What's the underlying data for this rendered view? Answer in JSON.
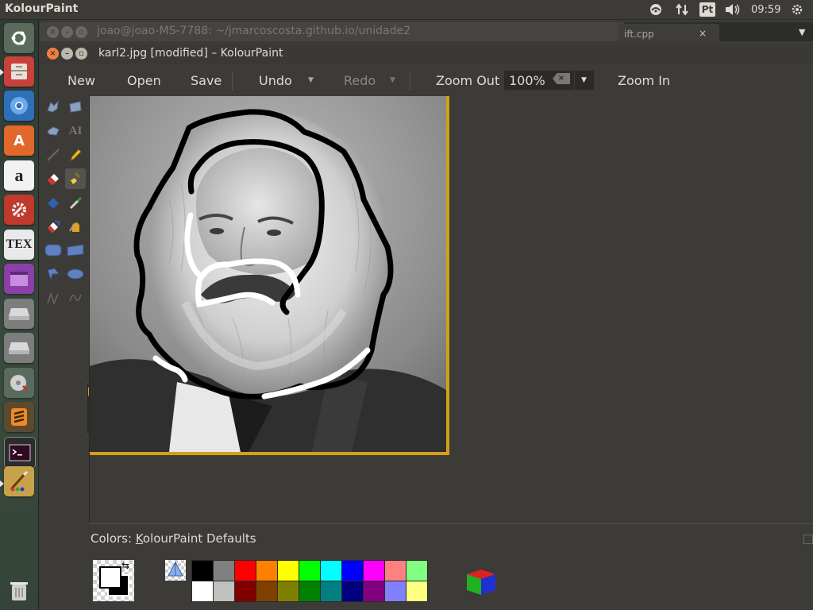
{
  "top_panel": {
    "app_name": "KolourPaint",
    "lang": "Pt",
    "volume_icon": "speaker-icon",
    "time": "09:59"
  },
  "launcher": {
    "items": [
      {
        "name": "ubuntu-home",
        "icon": "ubuntu-logo-icon"
      },
      {
        "name": "files",
        "icon": "file-cabinet-icon"
      },
      {
        "name": "chromium",
        "icon": "browser-icon"
      },
      {
        "name": "software-center",
        "icon": "shopping-bag-icon"
      },
      {
        "name": "amazon",
        "icon": "amazon-icon"
      },
      {
        "name": "system-settings",
        "icon": "settings-icon"
      },
      {
        "name": "texmaker",
        "icon": "tex-icon"
      },
      {
        "name": "app-window",
        "icon": "window-icon"
      },
      {
        "name": "drive-1",
        "icon": "drive-icon"
      },
      {
        "name": "drive-2",
        "icon": "drive-icon"
      },
      {
        "name": "disk-utility",
        "icon": "disk-icon"
      },
      {
        "name": "sublime-text",
        "icon": "sublime-icon"
      },
      {
        "name": "terminal",
        "icon": "terminal-icon"
      },
      {
        "name": "kolourpaint",
        "icon": "kolourpaint-icon"
      },
      {
        "name": "trash",
        "icon": "trash-icon"
      }
    ]
  },
  "background_window": {
    "title": "joao@joao-MS-7788: ~/jmarcoscosta.github.io/unidade2",
    "tab_label": "ift.cpp",
    "tab_close": "×"
  },
  "window": {
    "title": "karl2.jpg [modified] – KolourPaint"
  },
  "toolbar": {
    "new": "New",
    "open": "Open",
    "save": "Save",
    "undo": "Undo",
    "redo": "Redo",
    "zoom_out": "Zoom Out",
    "zoom_value": "100%",
    "zoom_in": "Zoom In"
  },
  "colors": {
    "label_prefix": "Colors: ",
    "label_accel": "K",
    "label_rest": "olourPaint Defaults",
    "foreground": "#ffffff",
    "background": "#000000",
    "palette_top": [
      "#000000",
      "#808080",
      "#ff0000",
      "#ff8000",
      "#ffff00",
      "#00ff00",
      "#00ffff",
      "#0000ff",
      "#ff00ff",
      "#ff8080",
      "#80ff80"
    ],
    "palette_bottom": [
      "#ffffff",
      "#c0c0c0",
      "#800000",
      "#804000",
      "#808000",
      "#008000",
      "#008080",
      "#000080",
      "#800080",
      "#8080ff",
      "#ffff80"
    ]
  },
  "accent": "#d4a017"
}
